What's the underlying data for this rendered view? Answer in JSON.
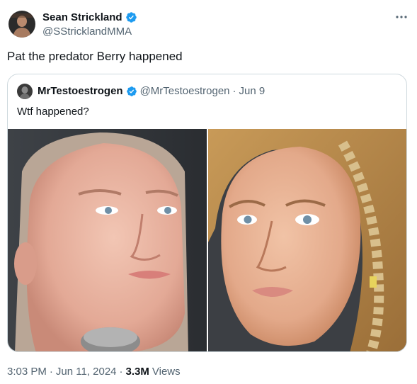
{
  "author": {
    "display_name": "Sean Strickland",
    "handle": "@SStricklandMMA",
    "verified_icon": "verified-badge-icon",
    "avatar_icon": "avatar"
  },
  "more_icon": "more-options-icon",
  "tweet": {
    "text": "Pat the predator Berry happened"
  },
  "quoted": {
    "display_name": "MrTestoestrogen",
    "handle": "@MrTestoestrogen",
    "separator": "·",
    "date": "Jun 9",
    "text": "Wtf happened?",
    "images": [
      "photo-left",
      "photo-right"
    ]
  },
  "meta": {
    "time": "3:03 PM",
    "dot1": "·",
    "date": "Jun 11, 2024",
    "dot2": "·",
    "views_count": "3.3M",
    "views_label": "Views"
  },
  "colors": {
    "verified": "#1d9bf0",
    "secondary_text": "#536471",
    "border": "#cfd9de"
  }
}
